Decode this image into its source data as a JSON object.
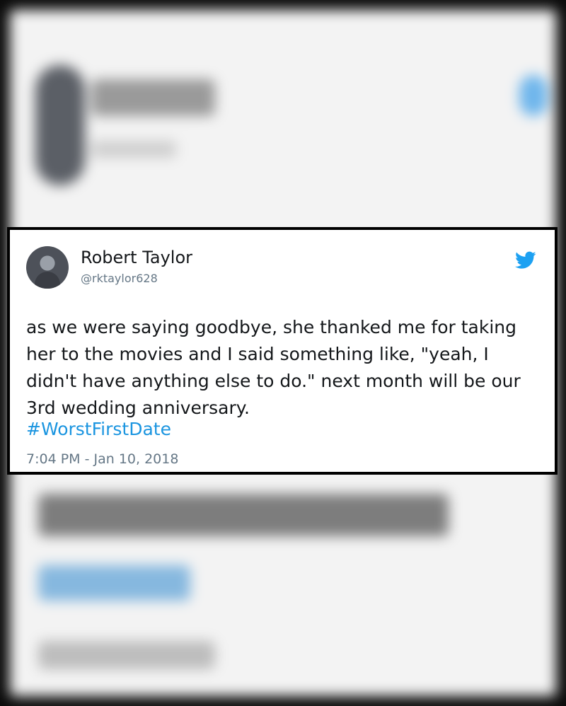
{
  "tweet": {
    "author_name": "Robert Taylor",
    "author_handle": "@rktaylor628",
    "text": "as we were saying goodbye, she thanked me for taking her to the movies and I said something like, \"yeah, I didn't have anything else to do.\" next month will be our 3rd wedding anniversary.",
    "hashtag": "#WorstFirstDate",
    "timestamp": "7:04 PM - Jan 10, 2018"
  },
  "icons": {
    "brand": "twitter-bird-icon",
    "avatar": "profile-photo"
  },
  "colors": {
    "brand_blue": "#1da1f2",
    "hashtag_blue": "#1b95e0",
    "text": "#14171a",
    "muted": "#657786",
    "frame": "#000000"
  }
}
